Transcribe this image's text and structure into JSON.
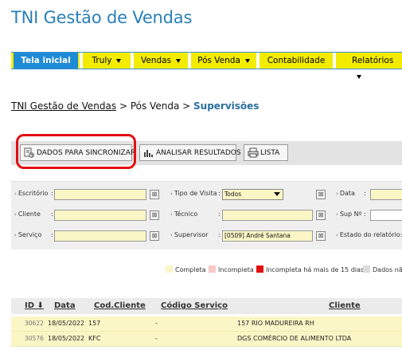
{
  "app": {
    "title": "TNI Gestão de Vendas"
  },
  "nav": {
    "items": [
      {
        "label": "Tela inicial",
        "active": true,
        "dropdown": false
      },
      {
        "label": "Truly",
        "dropdown": true
      },
      {
        "label": "Vendas",
        "dropdown": true
      },
      {
        "label": "Pós Venda",
        "dropdown": true
      },
      {
        "label": "Contabilidade",
        "dropdown": false
      },
      {
        "label": "Relatórios",
        "dropdown": true
      }
    ]
  },
  "breadcrumb": {
    "root": "TNI Gestão de Vendas",
    "sep1": ">",
    "section": "Pós Venda",
    "sep2": ">",
    "current": "Supervisões"
  },
  "toolbar": {
    "sync_label": "DADOS PARA SINCRONIZAR",
    "analyze_label": "ANALISAR RESULTADOS",
    "list_label": "LISTA"
  },
  "filters": {
    "escritorio": {
      "label": "Escritório",
      "value": ""
    },
    "tipo_visita": {
      "label": "Tipo de Visita",
      "value": "Todos"
    },
    "data": {
      "label": "Data",
      "value": ""
    },
    "cliente": {
      "label": "Cliente",
      "value": ""
    },
    "tecnico": {
      "label": "Técnico",
      "value": ""
    },
    "sup_no": {
      "label": "Sup Nº",
      "value": ""
    },
    "servico": {
      "label": "Serviço",
      "value": ""
    },
    "supervisor": {
      "label": "Supervisor",
      "value": "[0509] André Santana"
    },
    "estado": {
      "label": "Estado do relatório:",
      "value": ""
    },
    "colon": ":",
    "clear_glyph": "⊠"
  },
  "legend": {
    "items": [
      {
        "label": "Completa",
        "color": "#fbf6c6"
      },
      {
        "label": "Incompleta",
        "color": "#f8c8c8"
      },
      {
        "label": "Incompleta há mais de 15 dias",
        "color": "#e01010"
      },
      {
        "label": "Dados não",
        "color": "#dcdcdc"
      }
    ]
  },
  "table": {
    "columns": [
      "ID ⬇",
      "Data",
      "Cod.Cliente",
      "Código Serviço",
      "Cliente"
    ],
    "rows": [
      {
        "id": "30622",
        "data": "18/05/2022",
        "cod_cliente": "157",
        "cod_servico": "-",
        "cliente": "157 RIO MADUREIRA RH"
      },
      {
        "id": "30576",
        "data": "18/05/2022",
        "cod_cliente": "KFC",
        "cod_servico": "-",
        "cliente": "DGS COMÉRCIO DE ALIMENTO LTDA"
      }
    ]
  },
  "colors": {
    "accent": "#2a7fb8",
    "nav_bg": "#f3ec00",
    "nav_active": "#1f8bd7",
    "row_bg": "#fbf6c6",
    "highlight": "#e01010"
  }
}
